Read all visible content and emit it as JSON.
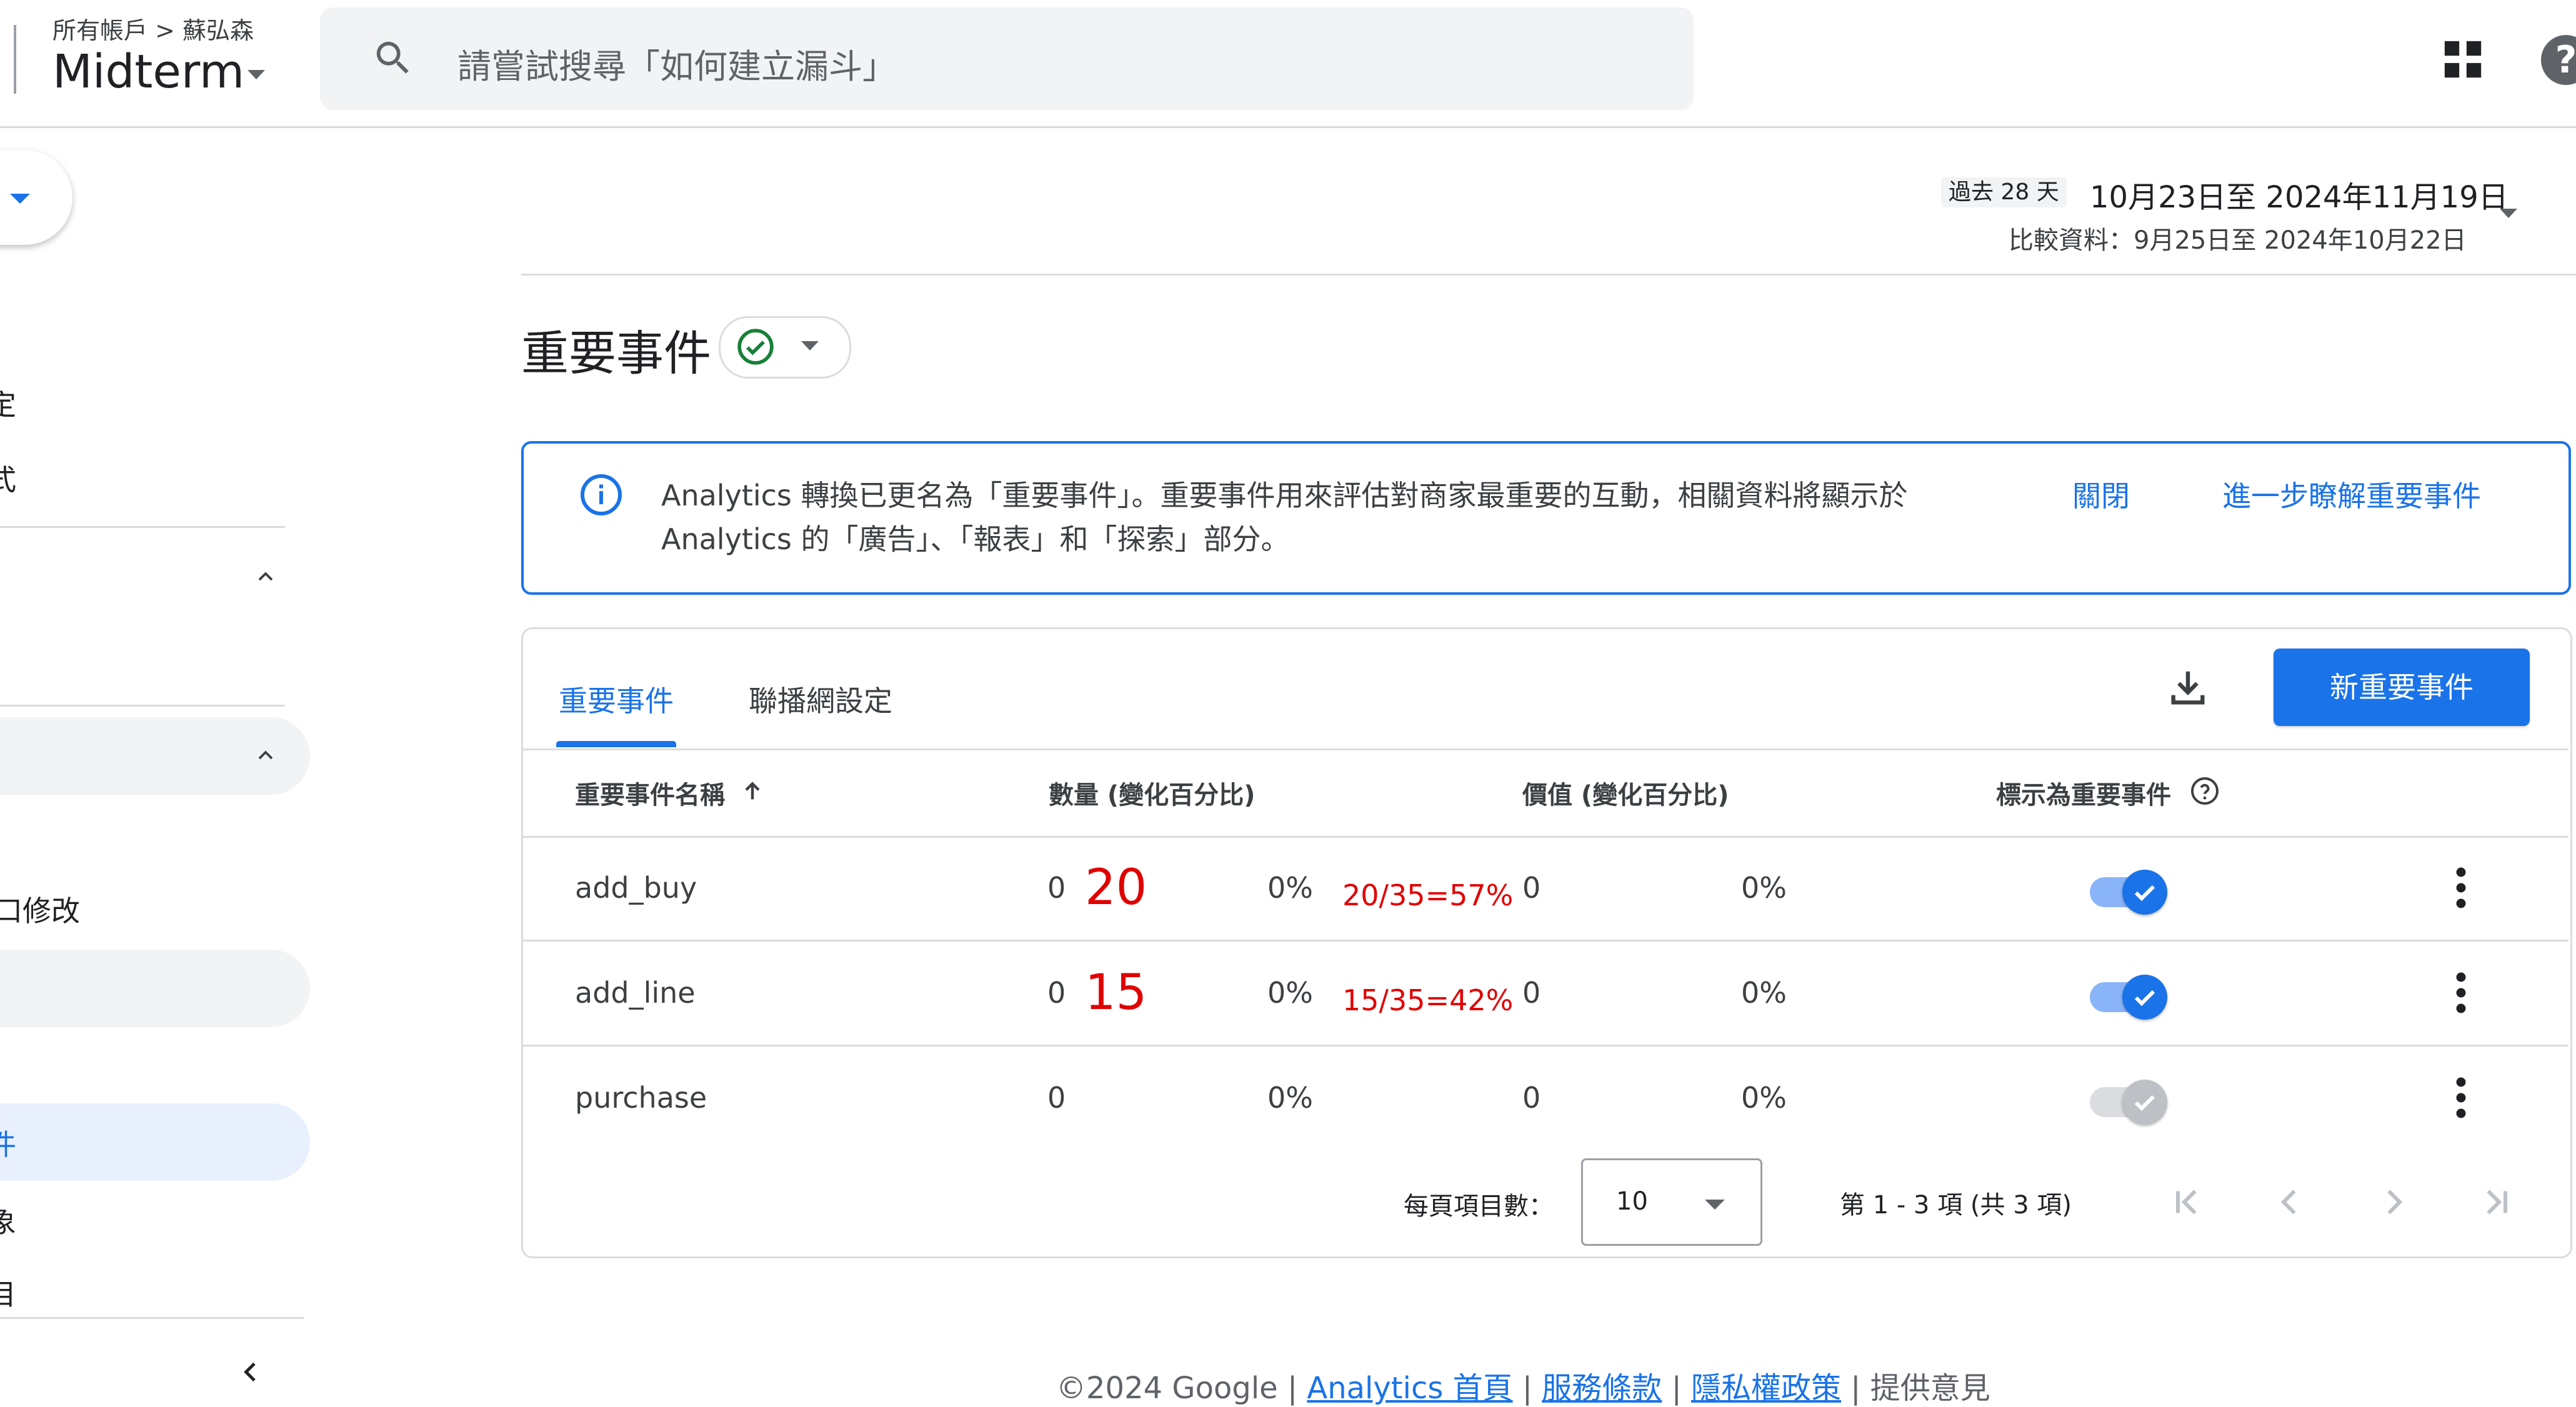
{
  "header": {
    "breadcrumb": "所有帳戶 > 蘇弘森",
    "property_name": "Midterm",
    "search_placeholder": "請嘗試搜尋「如何建立漏斗」",
    "help_glyph": "?"
  },
  "sidebar": {
    "fragment_1": "定",
    "fragment_2": "式",
    "fragment_3": "口修改",
    "fragment_4": "件",
    "fragment_5": "象",
    "fragment_6": "目"
  },
  "date_range": {
    "tag": "過去 28 天",
    "range": "10月23日至 2024年11月19日",
    "compare": "比較資料：9月25日至 2024年10月22日"
  },
  "page": {
    "title": "重要事件"
  },
  "banner": {
    "text": "Analytics 轉換已更名為「重要事件」。重要事件用來評估對商家最重要的互動，相關資料將顯示於 Analytics 的「廣告」、「報表」和「探索」部分。",
    "close_label": "關閉",
    "learn_more_label": "進一步瞭解重要事件"
  },
  "tabs": [
    {
      "label": "重要事件",
      "active": true
    },
    {
      "label": "聯播網設定",
      "active": false
    }
  ],
  "actions": {
    "new_button_label": "新重要事件"
  },
  "table": {
    "columns": [
      "重要事件名稱",
      "數量 (變化百分比)",
      "價值 (變化百分比)",
      "標示為重要事件"
    ],
    "rows": [
      {
        "name": "add_buy",
        "count": "0",
        "count_change": "0%",
        "value": "0",
        "value_change": "0%",
        "key_event": true,
        "annot_big": "20",
        "annot_small": "20/35=57%"
      },
      {
        "name": "add_line",
        "count": "0",
        "count_change": "0%",
        "value": "0",
        "value_change": "0%",
        "key_event": true,
        "annot_big": "15",
        "annot_small": "15/35=42%"
      },
      {
        "name": "purchase",
        "count": "0",
        "count_change": "0%",
        "value": "0",
        "value_change": "0%",
        "key_event": false
      }
    ]
  },
  "pagination": {
    "per_page_label": "每頁項目數：",
    "per_page_value": "10",
    "range_text": "第 1 - 3 項 (共 3 項)"
  },
  "footer": {
    "prefix": "©2024 Google | ",
    "link_home": "Analytics 首頁",
    "sep1": " | ",
    "link_terms": "服務條款",
    "sep2": " | ",
    "link_privacy": "隱私權政策",
    "sep3": " | ",
    "feedback": "提供意見"
  },
  "colors": {
    "accent": "#1a73e8",
    "annotation": "#e00000",
    "success": "#188038"
  }
}
